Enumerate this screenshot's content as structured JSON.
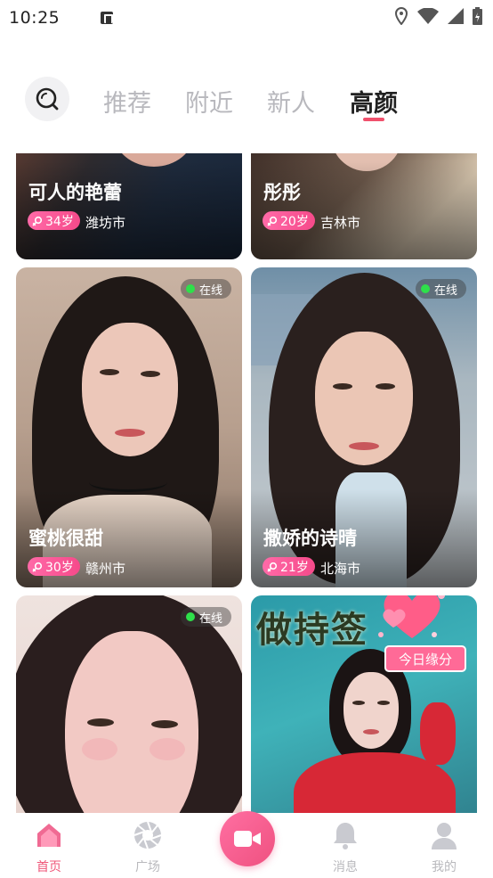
{
  "status_bar": {
    "time": "10:25"
  },
  "tabs": [
    {
      "label": "推荐",
      "active": false
    },
    {
      "label": "附近",
      "active": false
    },
    {
      "label": "新人",
      "active": false
    },
    {
      "label": "高颜",
      "active": true
    }
  ],
  "cards": [
    {
      "name": "可人的艳蕾",
      "age": "34岁",
      "city": "潍坊市",
      "online": ""
    },
    {
      "name": "彤彤",
      "age": "20岁",
      "city": "吉林市",
      "online": ""
    },
    {
      "name": "蜜桃很甜",
      "age": "30岁",
      "city": "赣州市",
      "online": "在线"
    },
    {
      "name": "撒娇的诗晴",
      "age": "21岁",
      "city": "北海市",
      "online": "在线"
    },
    {
      "name": "",
      "age": "",
      "city": "",
      "online": "在线"
    },
    {
      "name": "",
      "age": "",
      "city": "",
      "online": "",
      "banner_text": "做持签",
      "promo_button": "今日缘分"
    }
  ],
  "bottom_nav": [
    {
      "label": "首页",
      "icon": "home-icon",
      "active": true
    },
    {
      "label": "广场",
      "icon": "aperture-icon",
      "active": false
    },
    {
      "label": "",
      "icon": "video-camera-icon",
      "active": false
    },
    {
      "label": "消息",
      "icon": "bell-icon",
      "active": false
    },
    {
      "label": "我的",
      "icon": "user-icon",
      "active": false
    }
  ],
  "colors": {
    "accent": "#f0506c",
    "age_badge": "#f64a8a",
    "online_dot": "#2ee04a"
  }
}
